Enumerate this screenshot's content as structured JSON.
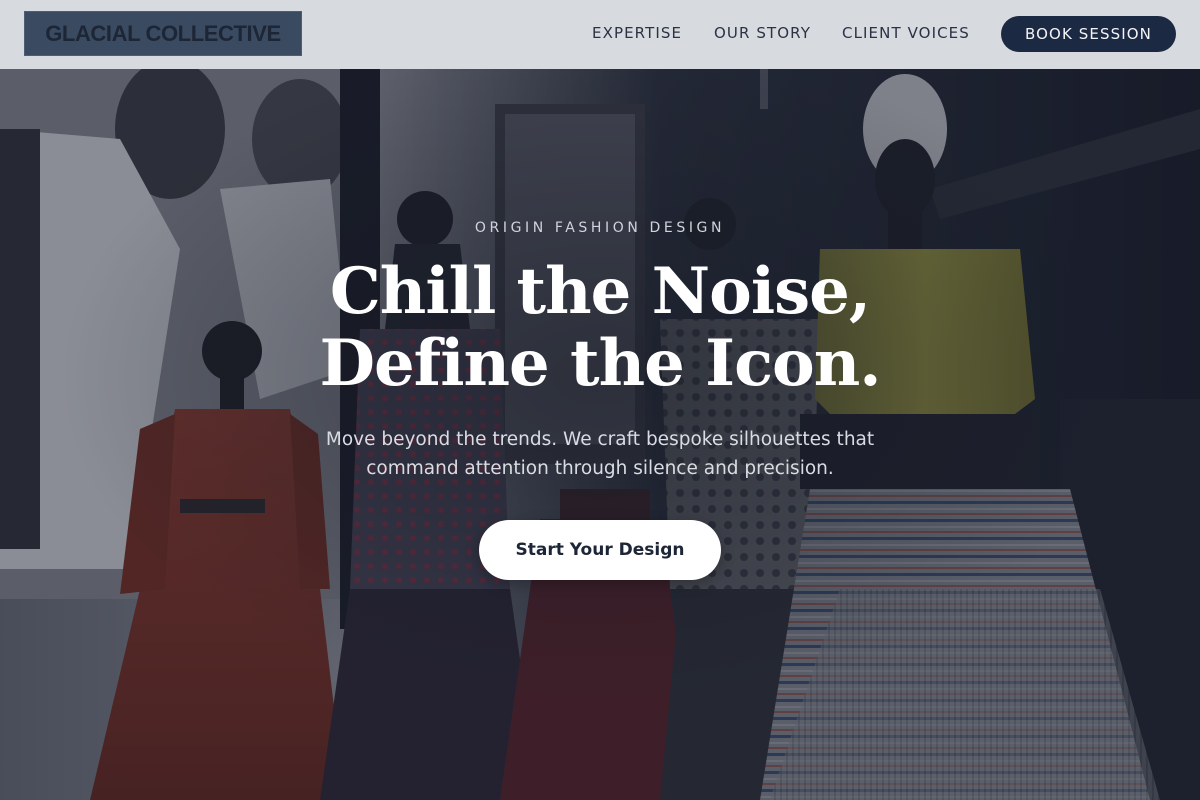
{
  "header": {
    "logo_text": "GLACIAL COLLECTIVE",
    "nav": [
      {
        "label": "EXPERTISE"
      },
      {
        "label": "OUR STORY"
      },
      {
        "label": "CLIENT VOICES"
      }
    ],
    "cta_label": "BOOK SESSION"
  },
  "hero": {
    "eyebrow": "ORIGIN FASHION DESIGN",
    "headline_line1": "Chill the Noise,",
    "headline_line2": "Define the Icon.",
    "subtext_line1": "Move beyond the trends. We craft bespoke silhouettes that",
    "subtext_line2": "command attention through silence and precision.",
    "button_label": "Start Your Design",
    "background_image": "fashion-exhibition-mannequins-photo"
  },
  "colors": {
    "header_bg": "#dee0e4",
    "logo_bg": "#3a4a60",
    "logo_text": "#1d2636",
    "nav_text": "#2a3244",
    "cta_bg": "#1c2942",
    "cta_text": "#f3f4f7",
    "hero_overlay": "#1c2230",
    "hero_button_bg": "#ffffff"
  }
}
